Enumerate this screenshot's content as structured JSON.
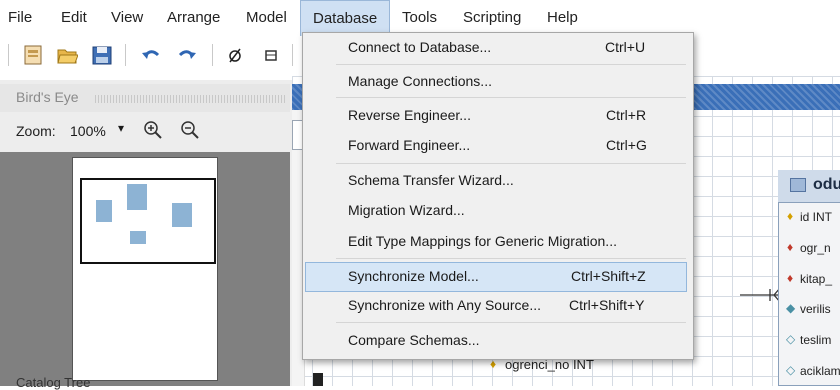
{
  "menubar": {
    "items": [
      "File",
      "Edit",
      "View",
      "Arrange",
      "Model",
      "Database",
      "Tools",
      "Scripting",
      "Help"
    ],
    "open_index": 5
  },
  "toolbar": {
    "icons": [
      "new-document-icon",
      "open-folder-icon",
      "save-icon",
      "undo-icon",
      "redo-icon",
      "null-toggle-icon",
      "table-icon"
    ]
  },
  "birds_eye": {
    "title": "Bird's Eye",
    "zoom_label": "Zoom:",
    "zoom_value": "100%",
    "zoom_in_icon": "zoom-in-icon",
    "zoom_out_icon": "zoom-out-icon",
    "bottom_label": "Catalog Tree"
  },
  "database_menu": {
    "items": [
      {
        "label": "Connect to Database...",
        "shortcut": "Ctrl+U"
      },
      {
        "label": "Manage Connections...",
        "shortcut": ""
      },
      {
        "label": "Reverse Engineer...",
        "shortcut": "Ctrl+R"
      },
      {
        "label": "Forward Engineer...",
        "shortcut": "Ctrl+G"
      },
      {
        "label": "Schema Transfer Wizard...",
        "shortcut": ""
      },
      {
        "label": "Migration Wizard...",
        "shortcut": ""
      },
      {
        "label": "Edit Type Mappings for Generic Migration...",
        "shortcut": ""
      },
      {
        "label": "Synchronize Model...",
        "shortcut": "Ctrl+Shift+Z"
      },
      {
        "label": "Synchronize with Any Source...",
        "shortcut": "Ctrl+Shift+Y"
      },
      {
        "label": "Compare Schemas...",
        "shortcut": ""
      }
    ],
    "highlighted_index": 7
  },
  "canvas": {
    "table": {
      "name": "odu",
      "columns": [
        {
          "text": "id INT",
          "key": "primary"
        },
        {
          "text": "ogr_n",
          "key": "foreign"
        },
        {
          "text": "kitap_",
          "key": "foreign"
        },
        {
          "text": "verilis",
          "key": "filled"
        },
        {
          "text": "teslim",
          "key": "empty"
        },
        {
          "text": "aciklam",
          "key": "empty"
        }
      ]
    },
    "behind_menu_row": "ogrenci_no INT"
  },
  "colors": {
    "menu_open_bg": "#cfe0f3",
    "highlight_bg": "#d6e6f6",
    "canvas_header": "#3a6fb8",
    "primary_key": "#d4a000",
    "foreign_key": "#c0392b",
    "attribute": "#4a90a4"
  }
}
